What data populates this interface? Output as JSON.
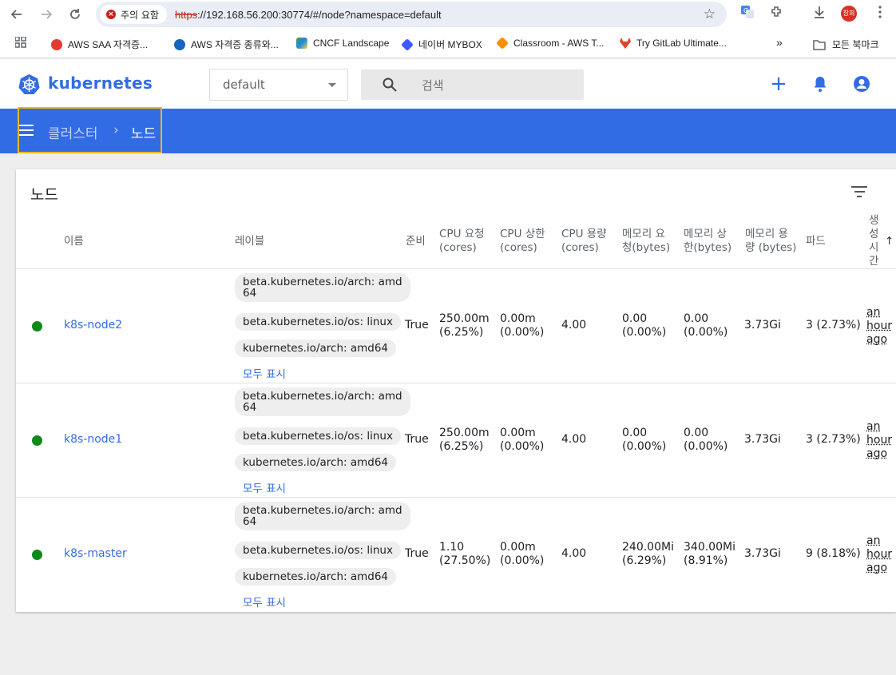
{
  "browser": {
    "warning_label": "주의 요함",
    "url_scheme": "https",
    "url_rest": "://192.168.56.200:30774/#/node?namespace=default",
    "avatar_text": "창희"
  },
  "bookmarks": [
    {
      "label": "AWS SAA 자격증...",
      "color": "#e53935"
    },
    {
      "label": "AWS 자격증 종류와...",
      "color": "#1565c0"
    },
    {
      "label": "CNCF Landscape",
      "color": "#43a047"
    },
    {
      "label": "네이버 MYBOX",
      "color": "#3d5afe"
    },
    {
      "label": "Classroom - AWS T...",
      "color": "#ff8f00"
    },
    {
      "label": "Try GitLab Ultimate...",
      "color": "#e24329"
    }
  ],
  "bookmarks_more": "»",
  "bookmarks_all": "모든 북마크",
  "header": {
    "brand": "kubernetes",
    "namespace": "default",
    "search_placeholder": "검색"
  },
  "breadcrumb": {
    "parent": "클러스터",
    "separator": "›",
    "current": "노드"
  },
  "card": {
    "title": "노드"
  },
  "columns": {
    "name": "이름",
    "labels": "레이블",
    "ready": "준비",
    "cpu_req": "CPU 요청\n(cores)",
    "cpu_lim": "CPU 상한\n(cores)",
    "cpu_cap": "CPU 용량\n(cores)",
    "mem_req": "메모리 요\n청(bytes)",
    "mem_lim": "메모리 상\n한(bytes)",
    "mem_cap": "메모리 용\n량 (bytes)",
    "pods": "파드",
    "created": "생\n성\n시\n간",
    "sort_arrow": "↑"
  },
  "nodes": [
    {
      "name": "k8s-node2",
      "labels": [
        "beta.kubernetes.io/arch: amd\n64",
        "beta.kubernetes.io/os: linux",
        "kubernetes.io/arch: amd64"
      ],
      "show_all": "모두 표시",
      "ready": "True",
      "cpu_req": "250.00m\n(6.25%)",
      "cpu_lim": "0.00m\n(0.00%)",
      "cpu_cap": "4.00",
      "mem_req": "0.00\n(0.00%)",
      "mem_lim": "0.00\n(0.00%)",
      "mem_cap": "3.73Gi",
      "pods": "3 (2.73%)",
      "age": "an\nhour\nago"
    },
    {
      "name": "k8s-node1",
      "labels": [
        "beta.kubernetes.io/arch: amd\n64",
        "beta.kubernetes.io/os: linux",
        "kubernetes.io/arch: amd64"
      ],
      "show_all": "모두 표시",
      "ready": "True",
      "cpu_req": "250.00m\n(6.25%)",
      "cpu_lim": "0.00m\n(0.00%)",
      "cpu_cap": "4.00",
      "mem_req": "0.00\n(0.00%)",
      "mem_lim": "0.00\n(0.00%)",
      "mem_cap": "3.73Gi",
      "pods": "3 (2.73%)",
      "age": "an\nhour\nago"
    },
    {
      "name": "k8s-master",
      "labels": [
        "beta.kubernetes.io/arch: amd\n64",
        "beta.kubernetes.io/os: linux",
        "kubernetes.io/arch: amd64"
      ],
      "show_all": "모두 표시",
      "ready": "True",
      "cpu_req": "1.10\n(27.50%)",
      "cpu_lim": "0.00m\n(0.00%)",
      "cpu_cap": "4.00",
      "mem_req": "240.00Mi\n(6.29%)",
      "mem_lim": "340.00Mi\n(8.91%)",
      "mem_cap": "3.73Gi",
      "pods": "9 (8.18%)",
      "age": "an\nhour\nago"
    }
  ]
}
